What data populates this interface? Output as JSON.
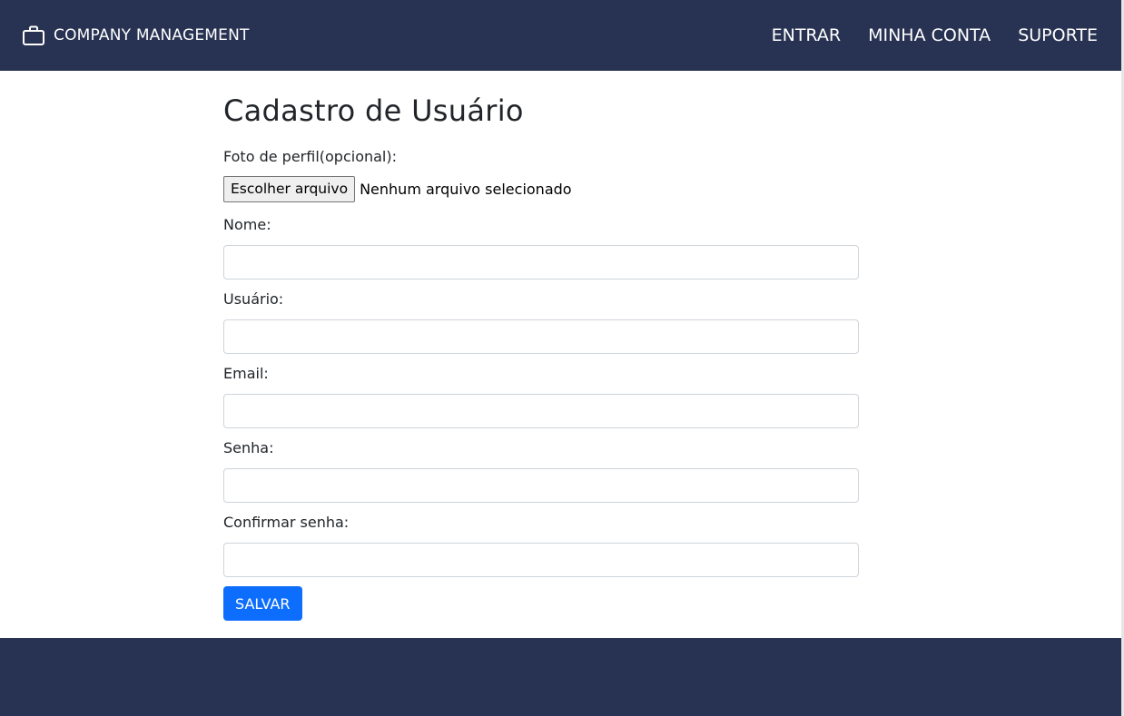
{
  "navbar": {
    "brand_icon": "briefcase-icon",
    "brand": "COMPANY MANAGEMENT",
    "links": [
      "ENTRAR",
      "MINHA CONTA",
      "SUPORTE"
    ]
  },
  "form": {
    "title": "Cadastro de Usuário",
    "photo_label": "Foto de perfil(opcional):",
    "file_button": "Escolher arquivo",
    "file_status": "Nenhum arquivo selecionado",
    "fields": [
      {
        "label": "Nome:",
        "value": ""
      },
      {
        "label": "Usuário:",
        "value": ""
      },
      {
        "label": "Email:",
        "value": ""
      },
      {
        "label": "Senha:",
        "value": ""
      },
      {
        "label": "Confirmar senha:",
        "value": ""
      }
    ],
    "save_label": "SALVAR"
  },
  "colors": {
    "navbar_bg": "#283252",
    "footer_bg": "#283252",
    "primary_button": "#0d6efd"
  }
}
